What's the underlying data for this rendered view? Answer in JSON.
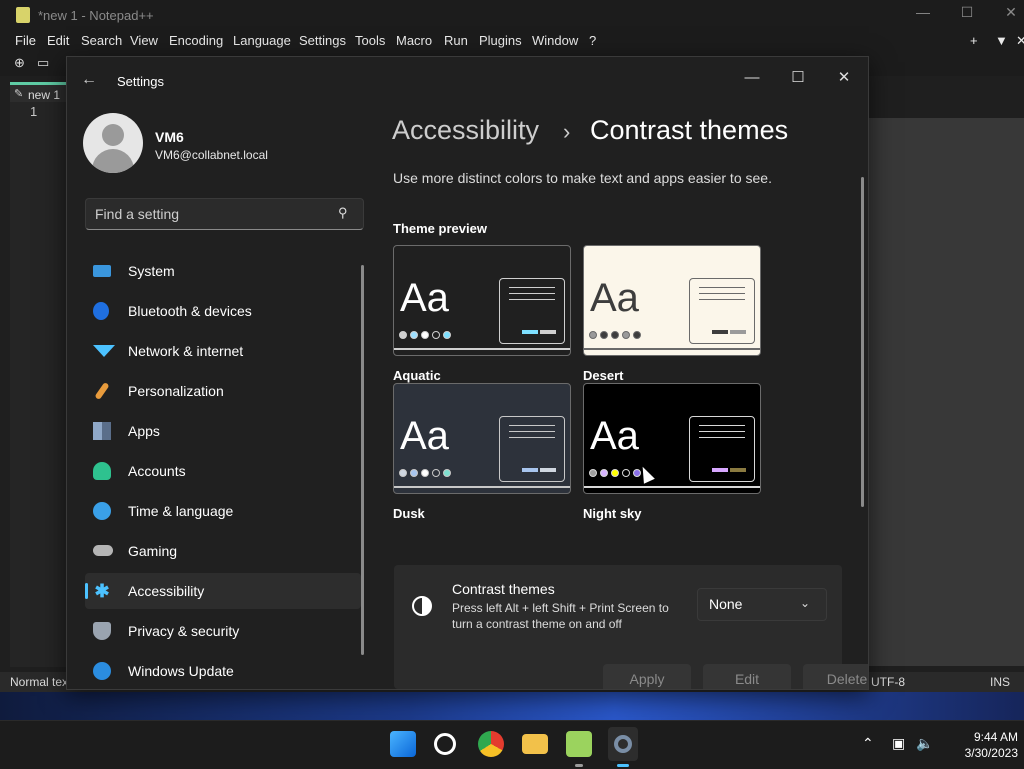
{
  "desktop": {
    "clock_time": "9:44 AM",
    "clock_date": "3/30/2023"
  },
  "notepad": {
    "title": "*new 1 - Notepad++",
    "menu": [
      "File",
      "Edit",
      "Search",
      "View",
      "Encoding",
      "Language",
      "Settings",
      "Tools",
      "Macro",
      "Run",
      "Plugins",
      "Window",
      "?"
    ],
    "tab_label": "new 1",
    "line_number": "1",
    "status_left": "Normal tex",
    "status_encoding": "UTF-8",
    "status_mode": "INS"
  },
  "settings": {
    "window_title": "Settings",
    "user": {
      "name": "VM6",
      "email": "VM6@collabnet.local"
    },
    "search": {
      "placeholder": "Find a setting"
    },
    "nav": [
      {
        "label": "System",
        "icon": "monitor-icon",
        "color": "#3a96dd"
      },
      {
        "label": "Bluetooth & devices",
        "icon": "bluetooth-icon",
        "color": "#1f6fe0"
      },
      {
        "label": "Network & internet",
        "icon": "wifi-icon",
        "color": "#4cc2ff"
      },
      {
        "label": "Personalization",
        "icon": "brush-icon",
        "color": "#e89b3c"
      },
      {
        "label": "Apps",
        "icon": "apps-icon",
        "color": "#8fa8c8"
      },
      {
        "label": "Accounts",
        "icon": "person-icon",
        "color": "#2ec28f"
      },
      {
        "label": "Time & language",
        "icon": "clock-globe-icon",
        "color": "#3aa0e8"
      },
      {
        "label": "Gaming",
        "icon": "gamepad-icon",
        "color": "#b5b5b5"
      },
      {
        "label": "Accessibility",
        "icon": "accessibility-icon",
        "color": "#4cc2ff"
      },
      {
        "label": "Privacy & security",
        "icon": "shield-icon",
        "color": "#9aa4b0"
      },
      {
        "label": "Windows Update",
        "icon": "update-icon",
        "color": "#2b8de0"
      }
    ],
    "selected_nav": "Accessibility",
    "breadcrumb": {
      "parent": "Accessibility",
      "separator": "›",
      "current": "Contrast themes"
    },
    "description": "Use more distinct colors to make text and apps easier to see.",
    "theme_preview_heading": "Theme preview",
    "themes": [
      {
        "name": "Aquatic",
        "bg": "#202020",
        "fg": "#ffffff",
        "line": "#d0d0d0",
        "dots": [
          "#cfcfcf",
          "#9edffe",
          "#ffffff",
          "#202020",
          "#7ee0ff"
        ],
        "btn_a": "#7ee0ff",
        "btn_b": "#cfcfcf"
      },
      {
        "name": "Desert",
        "bg": "#fbf6ea",
        "fg": "#3d3d3d",
        "line": "#6a6a6a",
        "dots": [
          "#9a9a9a",
          "#3d3d3d",
          "#3d3d3d",
          "#9a9a9a",
          "#3d3d3d"
        ],
        "btn_a": "#3d3d3d",
        "btn_b": "#9a9a9a"
      },
      {
        "name": "Dusk",
        "bg": "#2d323b",
        "fg": "#ffffff",
        "line": "#c8c8c8",
        "dots": [
          "#cfd6e0",
          "#a8c5ee",
          "#ffffff",
          "#2d323b",
          "#7fe0d0"
        ],
        "btn_a": "#a8c5ee",
        "btn_b": "#cfd6e0"
      },
      {
        "name": "Night sky",
        "bg": "#000000",
        "fg": "#ffffff",
        "line": "#d8d8d8",
        "dots": [
          "#a0a0a0",
          "#d7b5ff",
          "#ffff00",
          "#000000",
          "#8a6fe8"
        ],
        "btn_a": "#d7a8ff",
        "btn_b": "#8a7a40"
      }
    ],
    "contrast": {
      "title": "Contrast themes",
      "desc": "Press left Alt + left Shift + Print Screen to turn a contrast theme on and off",
      "selected": "None",
      "buttons": {
        "apply": "Apply",
        "edit": "Edit",
        "delete": "Delete"
      }
    }
  }
}
